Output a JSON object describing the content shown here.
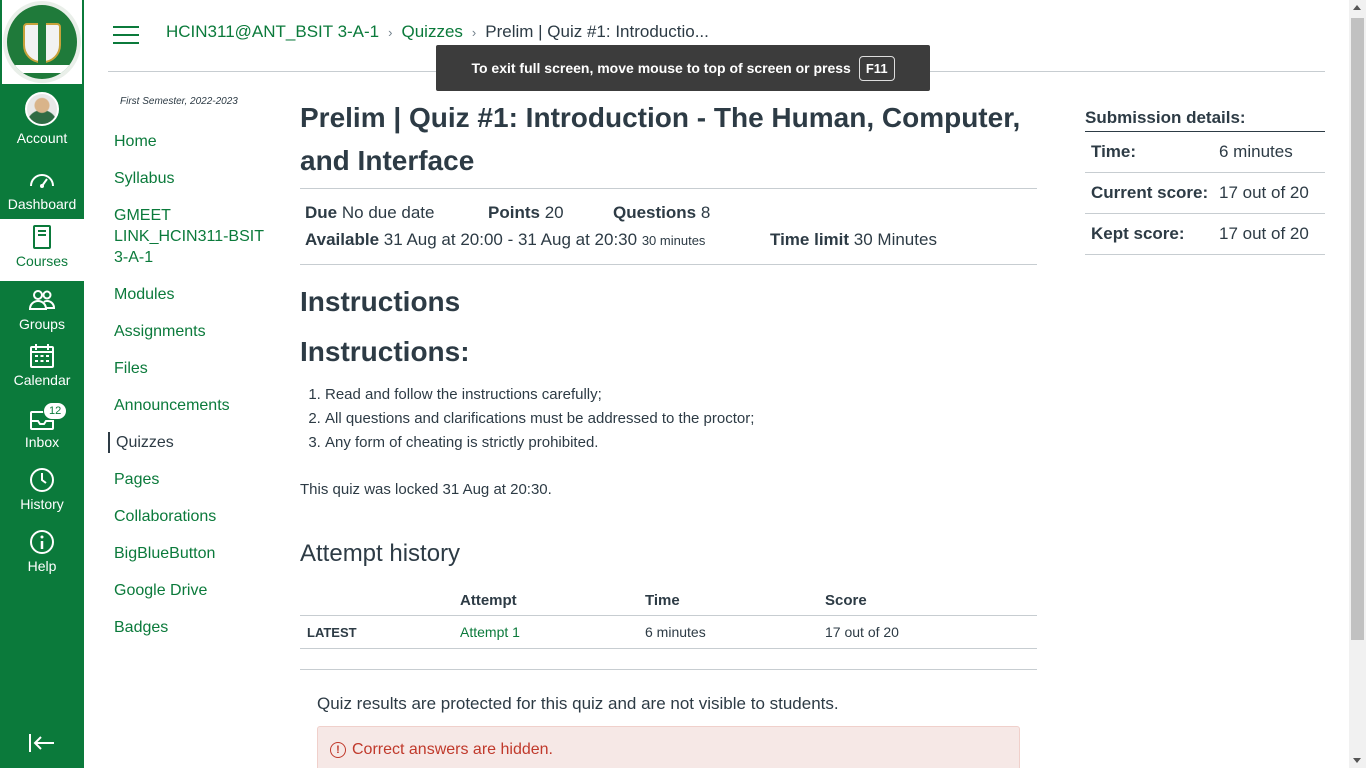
{
  "global_nav": {
    "account": "Account",
    "dashboard": "Dashboard",
    "courses": "Courses",
    "groups": "Groups",
    "calendar": "Calendar",
    "inbox": "Inbox",
    "inbox_badge": "12",
    "history": "History",
    "help": "Help"
  },
  "breadcrumbs": {
    "course": "HCIN311@ANT_BSIT 3-A-1",
    "quizzes": "Quizzes",
    "current": "Prelim | Quiz #1: Introductio..."
  },
  "fullscreen_toast": {
    "text": "To exit full screen, move mouse to top of screen or press",
    "key": "F11"
  },
  "course_nav": {
    "term": "First Semester, 2022-2023",
    "items": [
      "Home",
      "Syllabus",
      "GMEET LINK_HCIN311-BSIT 3-A-1",
      "Modules",
      "Assignments",
      "Files",
      "Announcements",
      "Quizzes",
      "Pages",
      "Collaborations",
      "BigBlueButton",
      "Google Drive",
      "Badges"
    ]
  },
  "quiz": {
    "title": "Prelim | Quiz #1: Introduction - The Human, Computer, and Interface",
    "due_label": "Due",
    "due_value": "No due date",
    "points_label": "Points",
    "points_value": "20",
    "questions_label": "Questions",
    "questions_value": "8",
    "available_label": "Available",
    "available_value": "31 Aug at 20:00 - 31 Aug at 20:30",
    "available_duration": "30 minutes",
    "time_limit_label": "Time limit",
    "time_limit_value": "30 Minutes",
    "instructions_heading": "Instructions",
    "instructions_subheading": "Instructions:",
    "instructions": [
      "Read and follow the instructions carefully;",
      "All questions and clarifications must be addressed to the proctor;",
      "Any form of cheating is strictly prohibited."
    ],
    "locked_text": "This quiz was locked 31 Aug at 20:30.",
    "attempt_history_heading": "Attempt history",
    "attempt_table": {
      "headers": [
        "",
        "Attempt",
        "Time",
        "Score"
      ],
      "rows": [
        [
          "LATEST",
          "Attempt 1",
          "6 minutes",
          "17 out of 20"
        ]
      ]
    },
    "protected_text": "Quiz results are protected for this quiz and are not visible to students.",
    "hidden_answers_text": "Correct answers are hidden."
  },
  "submission": {
    "heading": "Submission details:",
    "time_label": "Time:",
    "time_value": "6 minutes",
    "current_score_label": "Current score:",
    "current_score_value": "17 out of 20",
    "kept_score_label": "Kept score:",
    "kept_score_value": "17 out of 20"
  },
  "colors": {
    "brand_green": "#0b7a3b",
    "text": "#2d3b45",
    "alert_bg": "#f6e8e6",
    "alert_text": "#c0392b"
  }
}
